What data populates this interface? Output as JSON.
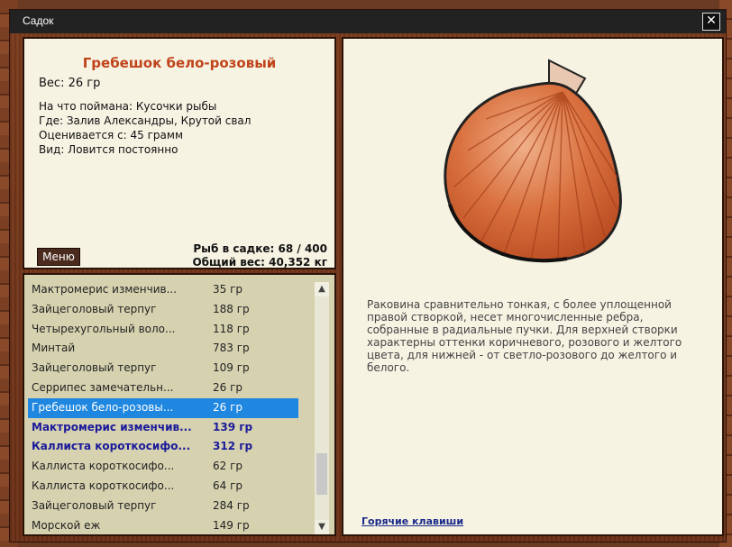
{
  "window": {
    "title": "Садок",
    "close_label": "✕"
  },
  "info": {
    "name": "Гребешок бело-розовый",
    "weight": "Вес: 26 гр",
    "caught_on": "На что поймана: Кусочки рыбы",
    "location": "Где: Залив Александры, Крутой свал",
    "valued": "Оценивается с: 45 грамм",
    "kind": "Вид: Ловится постоянно",
    "menu_label": "Меню",
    "fish_count": "Рыб в садке: 68 / 400",
    "total_weight": "Общий вес: 40,352 кг"
  },
  "list": {
    "rows": [
      {
        "name": "Мактромерис изменчив...",
        "weight": "35 гр"
      },
      {
        "name": "Зайцеголовый терпуг",
        "weight": "188 гр"
      },
      {
        "name": "Четырехугольный воло...",
        "weight": "118 гр"
      },
      {
        "name": "Минтай",
        "weight": "783 гр"
      },
      {
        "name": "Зайцеголовый терпуг",
        "weight": "109 гр"
      },
      {
        "name": "Серрипес замечательн...",
        "weight": "26 гр"
      },
      {
        "name": "Гребешок бело-розовы...",
        "weight": "26 гр"
      },
      {
        "name": "Мактромерис изменчив...",
        "weight": "139 гр"
      },
      {
        "name": "Каллиста короткосифо...",
        "weight": "312 гр"
      },
      {
        "name": "Каллиста короткосифо...",
        "weight": "62 гр"
      },
      {
        "name": "Каллиста короткосифо...",
        "weight": "64 гр"
      },
      {
        "name": "Зайцеголовый терпуг",
        "weight": "284 гр"
      },
      {
        "name": "Морской еж",
        "weight": "149 гр"
      }
    ],
    "scroll_up": "▲",
    "scroll_down": "▼"
  },
  "detail": {
    "description": "Раковина сравнительно тонкая, с более уплощенной правой створкой, несет многочисленные ребра, собранные в радиальные пучки. Для верхней створки характерны оттенки коричневого, розового и желтого цвета, для нижней - от светло-розового до желтого и белого.",
    "hotkeys": "Горячие клавиши"
  }
}
